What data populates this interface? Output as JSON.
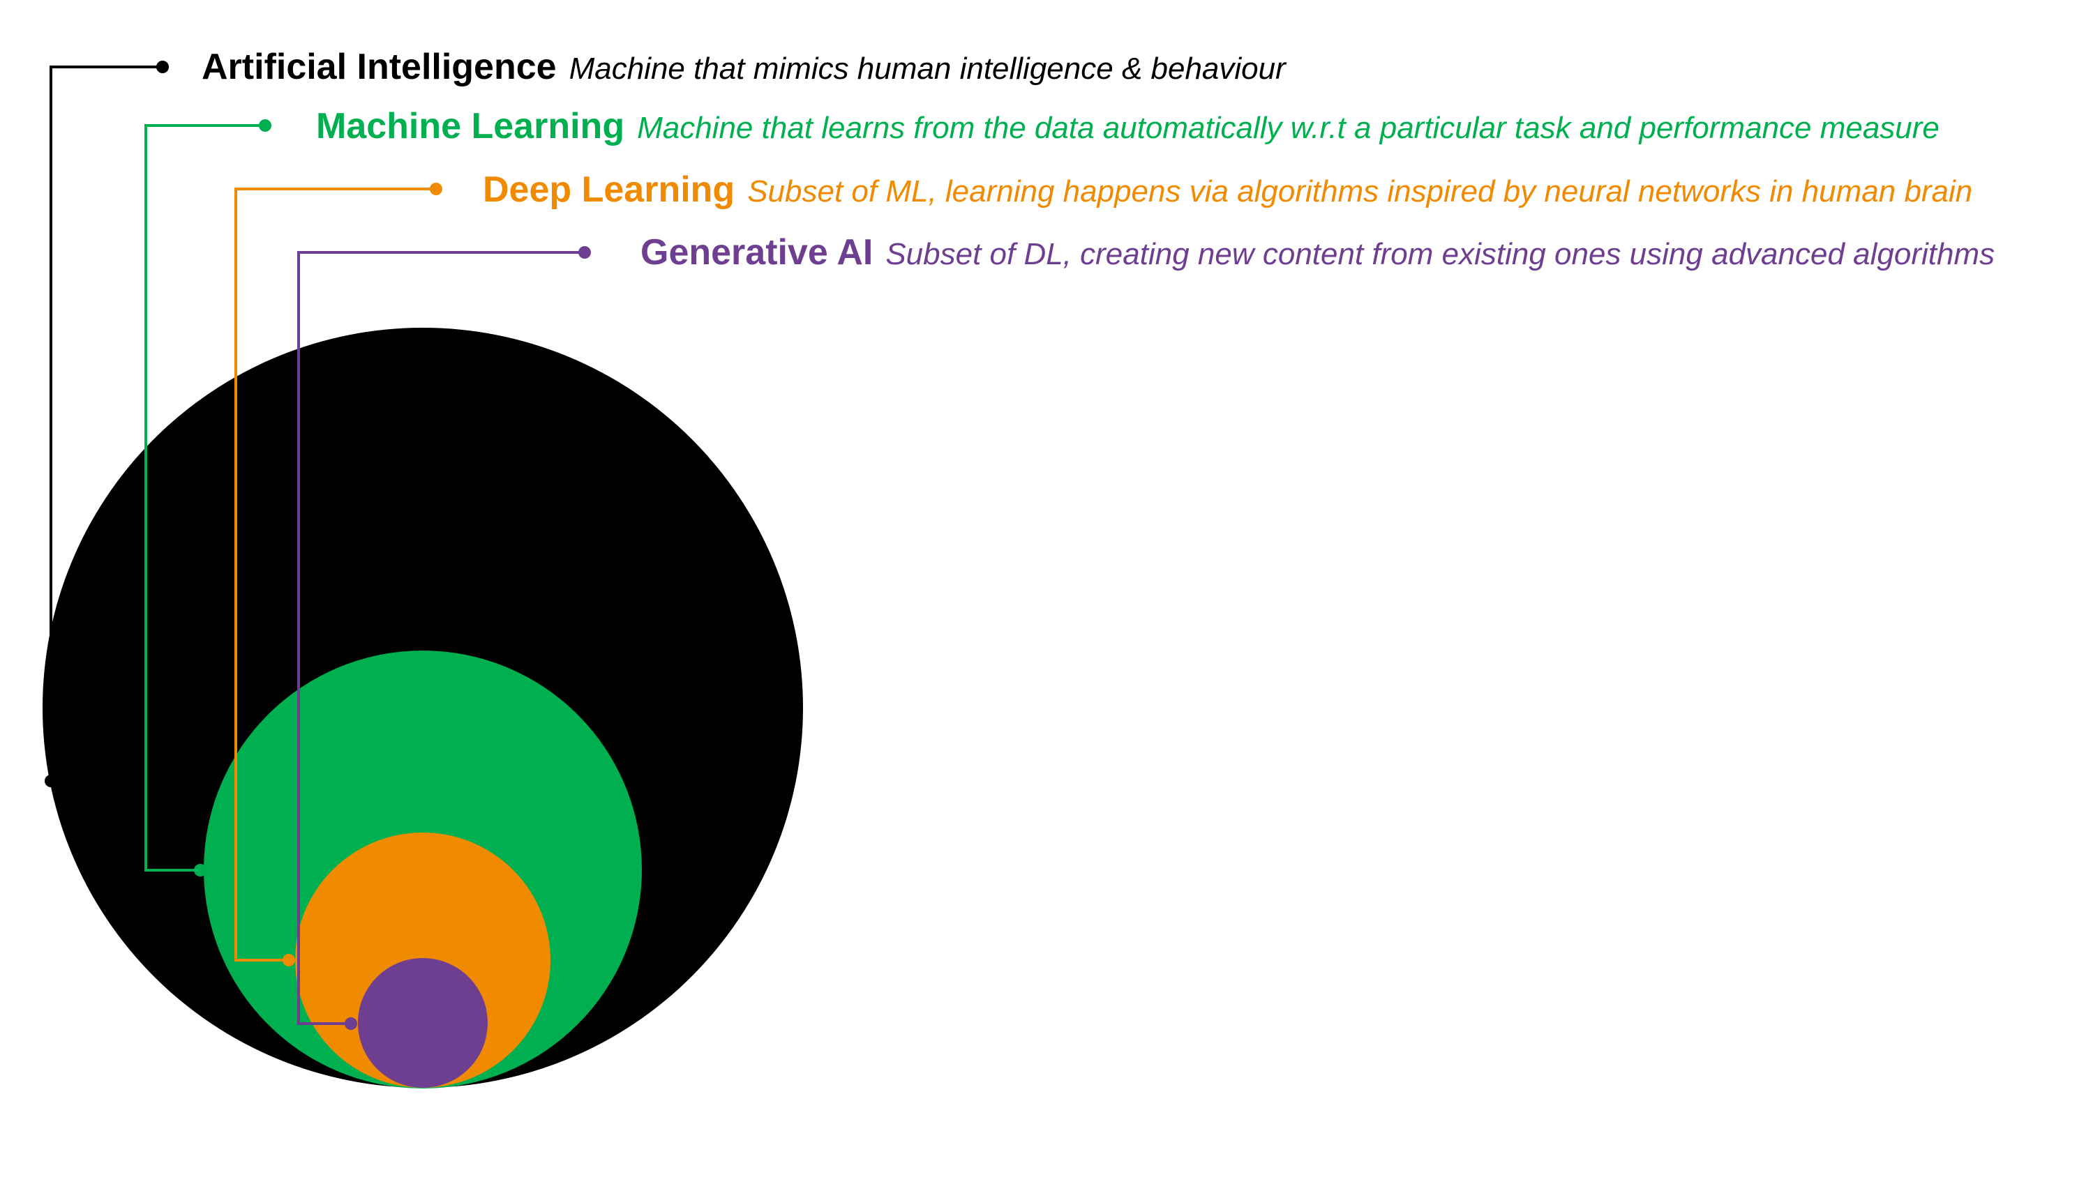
{
  "diagram": {
    "levels": [
      {
        "key": "ai",
        "term": "Artificial Intelligence",
        "description": "Machine that mimics human intelligence & behaviour",
        "color": "#000000"
      },
      {
        "key": "ml",
        "term": "Machine Learning",
        "description": "Machine that learns from the data automatically w.r.t a particular task and performance measure",
        "color": "#00B050"
      },
      {
        "key": "dl",
        "term": "Deep Learning",
        "description": "Subset of ML, learning happens via algorithms inspired by neural networks in human brain",
        "color": "#F08A00"
      },
      {
        "key": "genai",
        "term": "Generative AI",
        "description": "Subset of DL, creating new content from existing ones using advanced algorithms",
        "color": "#6E3F91"
      }
    ]
  }
}
